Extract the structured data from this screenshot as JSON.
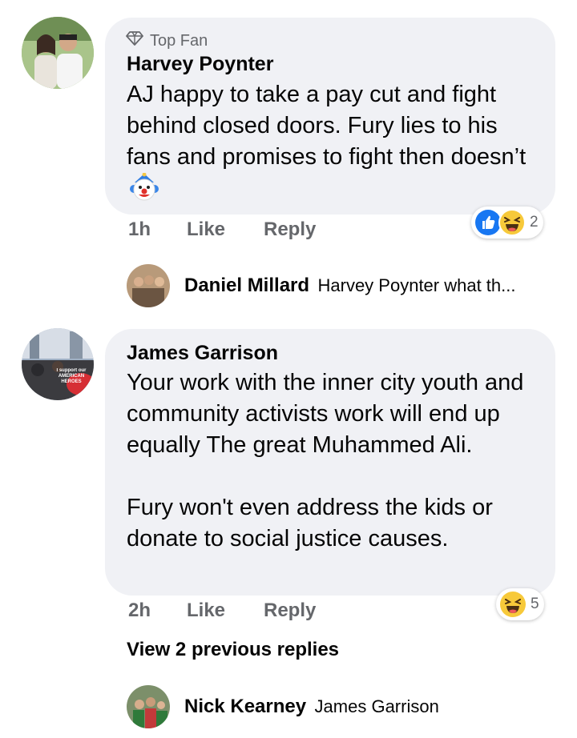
{
  "comments": [
    {
      "badge_label": "Top Fan",
      "badge_icon": "diamond-icon",
      "author": "Harvey Poynter",
      "text": "AJ happy to take a pay cut and fight behind closed doors. Fury lies to his fans and promises to fight then doesn’t",
      "emoji": "clown-face-icon",
      "time": "1h",
      "like_label": "Like",
      "reply_label": "Reply",
      "reactions": [
        "like-icon",
        "laugh-icon"
      ],
      "reaction_count": "2",
      "reply_preview": {
        "author": "Daniel Millard",
        "text": "Harvey Poynter what th..."
      }
    },
    {
      "author": "James Garrison",
      "text": "Your work with the inner city youth and community activists work will end up equally The great Muhammed Ali.\n\nFury won't even address the kids or donate to social justice causes.",
      "avatar_sign_text": "I support our AMERICAN HEROES",
      "time": "2h",
      "like_label": "Like",
      "reply_label": "Reply",
      "reactions": [
        "laugh-icon"
      ],
      "reaction_count": "5",
      "view_previous": "View 2 previous replies",
      "reply_preview": {
        "author": "Nick Kearney",
        "text": "James Garrison"
      }
    }
  ],
  "colors": {
    "bubble": "#f0f1f5",
    "meta": "#65676b",
    "like_blue": "#1877f2",
    "laugh_yellow": "#f7c93a"
  }
}
